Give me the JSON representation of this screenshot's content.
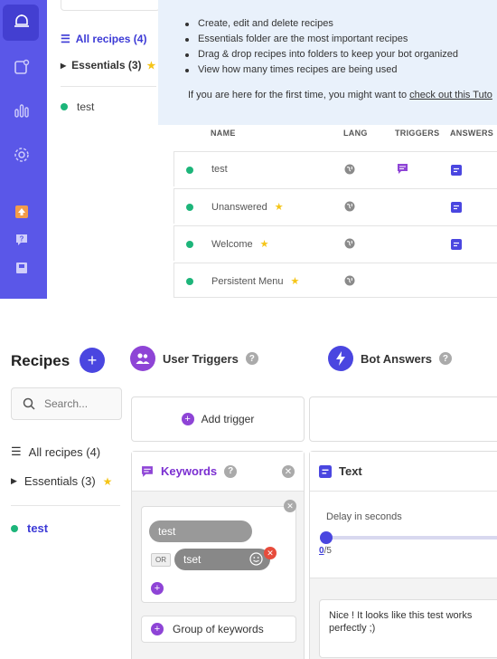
{
  "top": {
    "sidebar": {
      "icons": [
        "bell-icon",
        "edit-icon",
        "stats-icon",
        "gear-icon",
        "upload-icon",
        "help-chat-icon",
        "book-icon"
      ],
      "accent": "#5a57e8"
    },
    "folders": {
      "all_label": "All recipes (4)",
      "essentials_label": "Essentials (3)",
      "recipe": "test"
    },
    "info": {
      "bullets": [
        "Create, edit and delete recipes",
        "Essentials folder are the most important recipes",
        "Drag & drop recipes into folders to keep your bot organized",
        "View how many times recipes are being used"
      ],
      "footer_text": "If you are here for the first time, you might want to ",
      "footer_link": "check out this Tuto"
    },
    "table": {
      "headers": {
        "name": "NAME",
        "lang": "LANG",
        "triggers": "TRIGGERS",
        "answers": "ANSWERS"
      },
      "rows": [
        {
          "name": "test",
          "essential": false,
          "has_trigger": true,
          "has_answer": true
        },
        {
          "name": "Unanswered",
          "essential": true,
          "has_trigger": false,
          "has_answer": true
        },
        {
          "name": "Welcome",
          "essential": true,
          "has_trigger": false,
          "has_answer": true
        },
        {
          "name": "Persistent Menu",
          "essential": true,
          "has_trigger": false,
          "has_answer": false
        }
      ]
    }
  },
  "bottom": {
    "title": "Recipes",
    "add_symbol": "+",
    "search_placeholder": "Search...",
    "folders": {
      "all_label": "All recipes (4)",
      "essentials_label": "Essentials (3)",
      "recipe": "test"
    },
    "user_triggers": {
      "title": "User Triggers",
      "add_trigger": "Add trigger",
      "keywords_title": "Keywords",
      "keywords": [
        "test",
        "tset"
      ],
      "or_label": "OR",
      "group_label": "Group of keywords"
    },
    "bot_answers": {
      "title": "Bot Answers",
      "text_title": "Text",
      "delay_label": "Delay in seconds",
      "delay_value": "0",
      "delay_max": "/5",
      "message": "Nice ! It looks like this test works perfectly ;)"
    }
  }
}
